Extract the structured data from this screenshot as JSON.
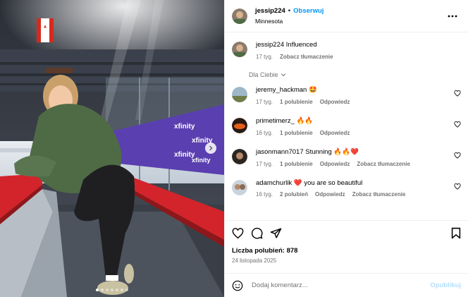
{
  "post": {
    "username": "jessip224",
    "separator": "•",
    "follow_label": "Obserwuj",
    "location": "Minnesota",
    "more_icon": "more-horizontal-icon",
    "caption": {
      "username": "jessip224",
      "text": "Influenced",
      "time": "17 tyg.",
      "translate": "Zobacz tłumaczenie"
    },
    "for_you_label": "Dla Ciebie",
    "likes_text": "Liczba polubień: 878",
    "date": "24 listopada 2025",
    "comment_placeholder": "Dodaj komentarz...",
    "post_button": "Opublikuj",
    "photo": {
      "slide_count": 7,
      "active_slide": 1,
      "brand_text": "xfinity"
    }
  },
  "comments": [
    {
      "username": "jeremy_hackman",
      "text": "🤩",
      "time": "17 tyg.",
      "likes": "1 polubienie",
      "reply": "Odpowiedz",
      "translate": ""
    },
    {
      "username": "primetimerz_",
      "text": "🔥🔥",
      "time": "16 tyg.",
      "likes": "1 polubienie",
      "reply": "Odpowiedz",
      "translate": ""
    },
    {
      "username": "jasonmann7017",
      "text": "Stunning 🔥🔥❤️",
      "time": "17 tyg.",
      "likes": "1 polubienie",
      "reply": "Odpowiedz",
      "translate": "Zobacz tłumaczenie"
    },
    {
      "username": "adamchurlik",
      "text": "❤️ you are so beautiful",
      "time": "16 tyg.",
      "likes": "2 polubień",
      "reply": "Odpowiedz",
      "translate": "Zobacz tłumaczenie"
    }
  ],
  "colors": {
    "accent": "#0095f6",
    "post_disabled": "#b2dffc",
    "meta": "#737373",
    "heart_emoji": "#e0245e"
  }
}
